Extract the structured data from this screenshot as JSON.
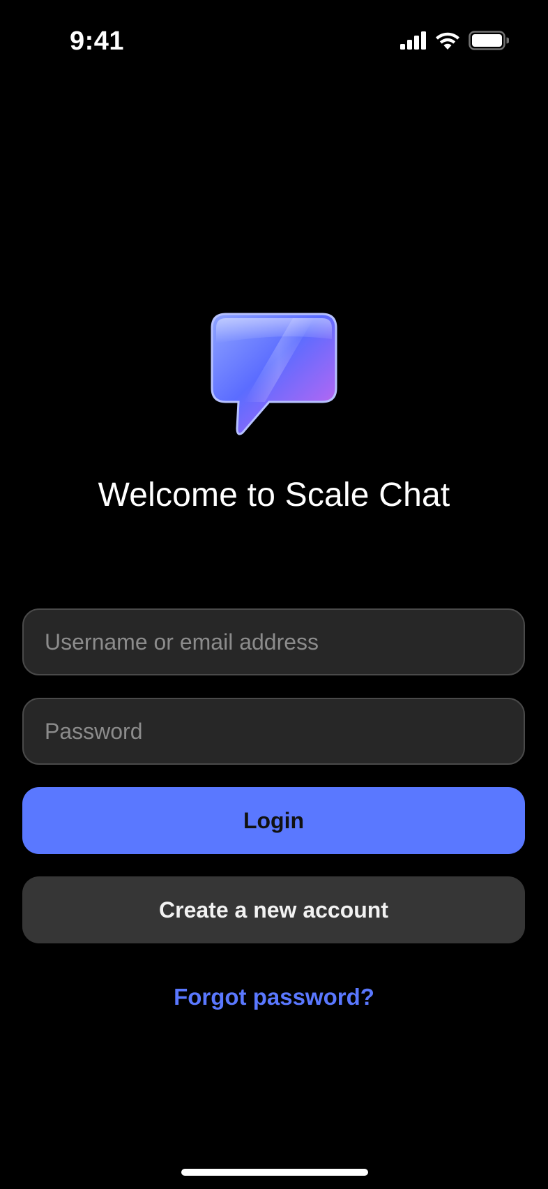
{
  "status_bar": {
    "time": "9:41",
    "icons": [
      "cellular-signal-icon",
      "wifi-icon",
      "battery-icon"
    ]
  },
  "logo": {
    "icon": "chat-bubble-logo-icon"
  },
  "welcome": {
    "title": "Welcome to Scale Chat"
  },
  "login_form": {
    "username_placeholder": "Username or email address",
    "username_value": "",
    "password_placeholder": "Password",
    "password_value": "",
    "login_label": "Login",
    "create_account_label": "Create a new account",
    "forgot_password_label": "Forgot password?"
  },
  "colors": {
    "background": "#000000",
    "accent": "#5a78ff",
    "field_background": "#272727",
    "secondary_button": "#363636"
  }
}
